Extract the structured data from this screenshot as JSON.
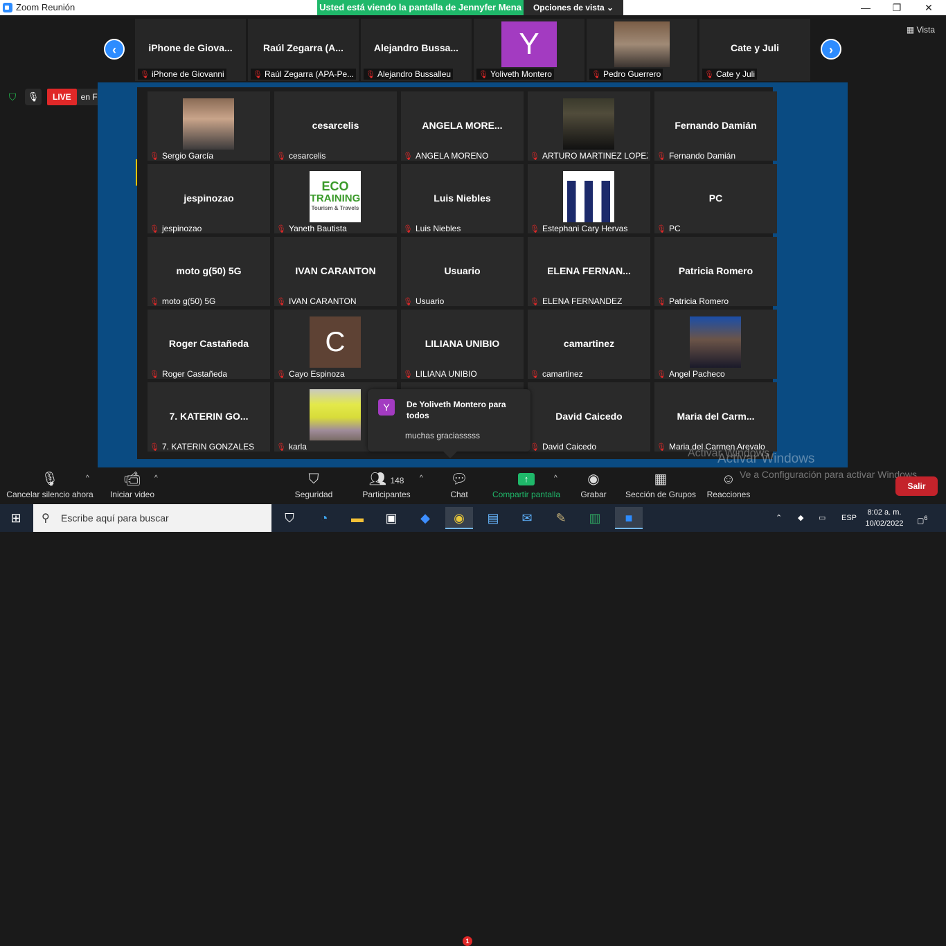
{
  "window": {
    "title": "Zoom Reunión",
    "minimize": "—",
    "maximize": "❐",
    "close": "✕"
  },
  "share_banner": {
    "text": "Usted está viendo la pantalla de Jennyfer Mena",
    "view_options": "Opciones de vista"
  },
  "vista_label": "Vista",
  "thumbnails": [
    {
      "big": "iPhone de Giova...",
      "name": "iPhone de Giovanni"
    },
    {
      "big": "Raúl Zegarra (A...",
      "name": "Raúl Zegarra (APA-Pe..."
    },
    {
      "big": "Alejandro Bussa...",
      "name": "Alejandro Bussalleu"
    },
    {
      "big": "Y",
      "name": "Yoliveth Montero"
    },
    {
      "big": "",
      "name": "Pedro Guerrero"
    },
    {
      "big": "Cate y Juli",
      "name": "Cate y Juli"
    }
  ],
  "live": {
    "label": "LIVE",
    "source": "en Facebook"
  },
  "gallery": [
    {
      "big": "",
      "name": "Sergio García"
    },
    {
      "big": "cesarcelis",
      "name": "cesarcelis"
    },
    {
      "big": "ANGELA MORE...",
      "name": "ANGELA MORENO"
    },
    {
      "big": "",
      "name": "ARTURO MARTINEZ LOPEZ"
    },
    {
      "big": "Fernando Damián",
      "name": "Fernando Damián"
    },
    {
      "big": "jespinozao",
      "name": "jespinozao"
    },
    {
      "big": "",
      "name": "Yaneth Bautista"
    },
    {
      "big": "Luis Niebles",
      "name": "Luis Niebles"
    },
    {
      "big": "",
      "name": "Estephani Cary Hervas"
    },
    {
      "big": "PC",
      "name": "PC"
    },
    {
      "big": "moto g(50) 5G",
      "name": "moto g(50) 5G"
    },
    {
      "big": "IVAN CARANTON",
      "name": "IVAN CARANTON"
    },
    {
      "big": "Usuario",
      "name": "Usuario"
    },
    {
      "big": "ELENA FERNAN...",
      "name": "ELENA FERNANDEZ"
    },
    {
      "big": "Patricia Romero",
      "name": "Patricia Romero"
    },
    {
      "big": "Roger Castañeda",
      "name": "Roger Castañeda"
    },
    {
      "big": "C",
      "name": "Cayo Espinoza"
    },
    {
      "big": "LILIANA UNIBIO",
      "name": "LILIANA UNIBIO"
    },
    {
      "big": "camartinez",
      "name": "camartinez"
    },
    {
      "big": "",
      "name": "Angel Pacheco"
    },
    {
      "big": "7. KATERIN GO...",
      "name": "7. KATERIN GONZALES"
    },
    {
      "big": "",
      "name": "karla"
    },
    {
      "big": "",
      "name": ""
    },
    {
      "big": "David Caicedo",
      "name": "David Caicedo"
    },
    {
      "big": "Maria del Carm...",
      "name": "Maria del Carmen Arevalo"
    }
  ],
  "logo_text": {
    "line1": "ECO",
    "line2": "TRAINING",
    "line3": "Tourism & Travels"
  },
  "chat_popup": {
    "avatar": "Y",
    "from": "De Yoliveth Montero para todos",
    "message": "muchas graciasssss"
  },
  "watermark": {
    "line1": "Activar Windows",
    "line2": "Activar Windows",
    "line3": "Ve a Configuración para activar Windows."
  },
  "toolbar": {
    "mute": "Cancelar silencio ahora",
    "video": "Iniciar video",
    "security": "Seguridad",
    "participants": "Participantes",
    "participants_count": "148",
    "chat": "Chat",
    "chat_badge": "1",
    "share": "Compartir pantalla",
    "record": "Grabar",
    "breakout": "Sección de Grupos",
    "reactions": "Reacciones",
    "leave": "Salir"
  },
  "taskbar": {
    "search_placeholder": "Escribe aquí para buscar",
    "lang": "ESP",
    "time": "8:02 a. m.",
    "date": "10/02/2022",
    "notifications": "6"
  },
  "colors": {
    "zoom_blue": "#2d8cff",
    "share_green": "#1fb86a",
    "live_red": "#e02828",
    "stage_blue": "#0a4b82"
  }
}
